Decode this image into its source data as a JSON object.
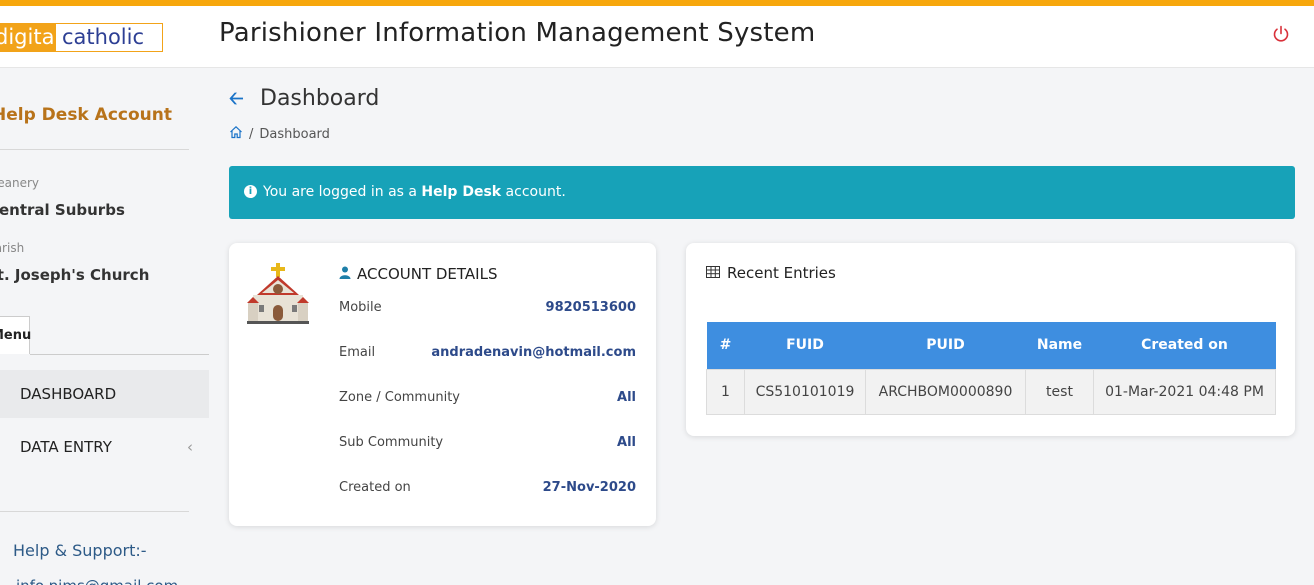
{
  "header": {
    "logo_left": "digital",
    "logo_right": "catholic",
    "title": "Parishioner Information Management System",
    "power_icon": "power-icon"
  },
  "sidebar": {
    "account_title": "Help Desk Account",
    "deanery_label": "Deanery",
    "deanery_value": "Central Suburbs",
    "parish_label": "Parish",
    "parish_value": "St. Joseph's Church",
    "tab_label": "Menu",
    "items": [
      {
        "label": "DASHBOARD"
      },
      {
        "label": "DATA ENTRY"
      }
    ],
    "help_title": "Help & Support:-",
    "help_email": "info.pims@gmail.com"
  },
  "page": {
    "title": "Dashboard",
    "breadcrumb_sep": "/",
    "breadcrumb_current": "Dashboard"
  },
  "alert": {
    "prefix": "You are logged in as a ",
    "bold": "Help Desk",
    "suffix": " account."
  },
  "account": {
    "heading": "ACCOUNT DETAILS",
    "rows": [
      {
        "label": "Mobile",
        "value": "9820513600"
      },
      {
        "label": "Email",
        "value": "andradenavin@hotmail.com"
      },
      {
        "label": "Zone / Community",
        "value": "All"
      },
      {
        "label": "Sub Community",
        "value": "All"
      },
      {
        "label": "Created on",
        "value": "27-Nov-2020"
      }
    ]
  },
  "recent": {
    "heading": "Recent Entries",
    "columns": [
      "#",
      "FUID",
      "PUID",
      "Name",
      "Created on"
    ],
    "rows": [
      [
        "1",
        "CS510101019",
        "ARCHBOM0000890",
        "test",
        "01-Mar-2021 04:48 PM"
      ]
    ]
  },
  "colors": {
    "accent": "#f7a70c",
    "alert": "#17a2b8",
    "table_header": "#3e8ee0"
  }
}
